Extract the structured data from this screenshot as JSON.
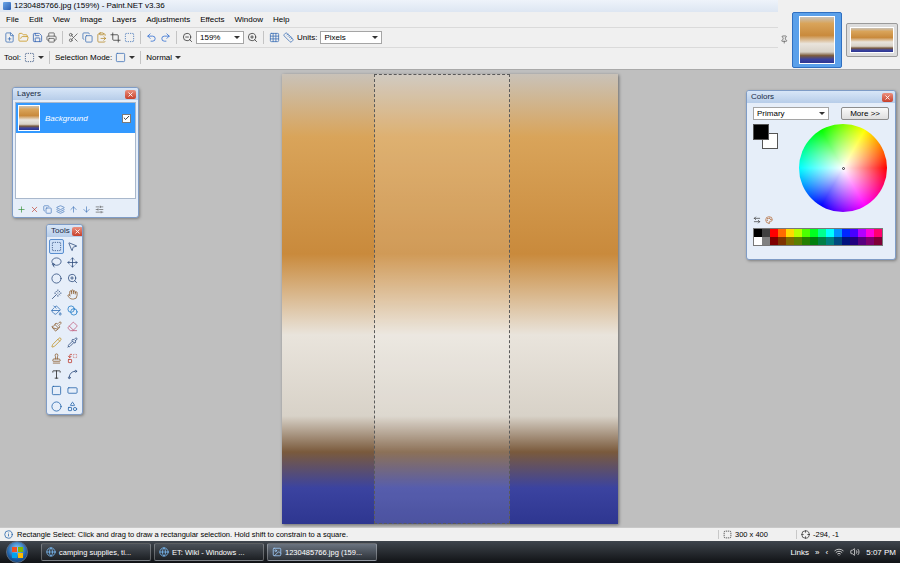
{
  "window": {
    "title": "1230485766.jpg (159%) - Paint.NET v3.36"
  },
  "menu": [
    "File",
    "Edit",
    "View",
    "Image",
    "Layers",
    "Adjustments",
    "Effects",
    "Window",
    "Help"
  ],
  "toolbar": {
    "zoom": "159%",
    "units_label": "Units:",
    "units": "Pixels"
  },
  "tool_options": {
    "tool_label": "Tool:",
    "selection_mode_label": "Selection Mode:",
    "blend_mode": "Normal"
  },
  "documents": [
    {
      "kind": "portrait",
      "selected": true
    },
    {
      "kind": "landscape",
      "selected": false
    }
  ],
  "layers_window": {
    "title": "Layers",
    "layers": [
      {
        "name": "Background",
        "visible": true,
        "selected": true
      }
    ]
  },
  "tools_window": {
    "title": "Tools",
    "tools": [
      {
        "selected": true
      },
      {
        "selected": false
      },
      {
        "selected": false
      },
      {
        "selected": false
      },
      {
        "selected": false
      },
      {
        "selected": false
      },
      {
        "selected": false
      },
      {
        "selected": false
      },
      {
        "selected": false
      },
      {
        "selected": false
      },
      {
        "selected": false
      },
      {
        "selected": false
      },
      {
        "selected": false
      },
      {
        "selected": false
      },
      {
        "selected": false
      },
      {
        "selected": false
      },
      {
        "selected": false
      },
      {
        "selected": false
      },
      {
        "selected": false
      },
      {
        "selected": false
      },
      {
        "selected": false
      },
      {
        "selected": false
      }
    ]
  },
  "colors_window": {
    "title": "Colors",
    "mode": "Primary",
    "more_button": "More >>",
    "primary": "#000000",
    "secondary": "#ffffff",
    "palette": [
      {
        "color": "#000000"
      },
      {
        "color": "#404040"
      },
      {
        "color": "#ff0000"
      },
      {
        "color": "#ff6a00"
      },
      {
        "color": "#ffd800"
      },
      {
        "color": "#b6ff00"
      },
      {
        "color": "#4cff00"
      },
      {
        "color": "#00ff21"
      },
      {
        "color": "#00ff90"
      },
      {
        "color": "#00ffff"
      },
      {
        "color": "#0094ff"
      },
      {
        "color": "#0026ff"
      },
      {
        "color": "#4800ff"
      },
      {
        "color": "#b200ff"
      },
      {
        "color": "#ff00dc"
      },
      {
        "color": "#ff006e"
      },
      {
        "color": "#ffffff"
      },
      {
        "color": "#808080"
      },
      {
        "color": "#7f0000"
      },
      {
        "color": "#7f3300"
      },
      {
        "color": "#7f6a00"
      },
      {
        "color": "#5b7f00"
      },
      {
        "color": "#267f00"
      },
      {
        "color": "#007f0e"
      },
      {
        "color": "#007f46"
      },
      {
        "color": "#007f7f"
      },
      {
        "color": "#004a7f"
      },
      {
        "color": "#00137f"
      },
      {
        "color": "#21007f"
      },
      {
        "color": "#57007f"
      },
      {
        "color": "#7f006e"
      },
      {
        "color": "#7f0037"
      }
    ]
  },
  "status_bar": {
    "hint": "Rectangle Select: Click and drag to draw a rectangular selection. Hold shift to constrain to a square.",
    "selection_size": "300 x 400",
    "cursor": "-294, -1"
  },
  "taskbar": {
    "tasks": [
      {
        "label": "camping supplies, ti...",
        "kind": "browser",
        "selected": false
      },
      {
        "label": "ET: Wiki - Windows ...",
        "kind": "browser",
        "selected": false
      },
      {
        "label": "1230485766.jpg (159...",
        "kind": "paint",
        "selected": true
      }
    ],
    "links": "Links",
    "chevron": "»",
    "tray_expand": "‹",
    "clock": "5:07 PM"
  }
}
